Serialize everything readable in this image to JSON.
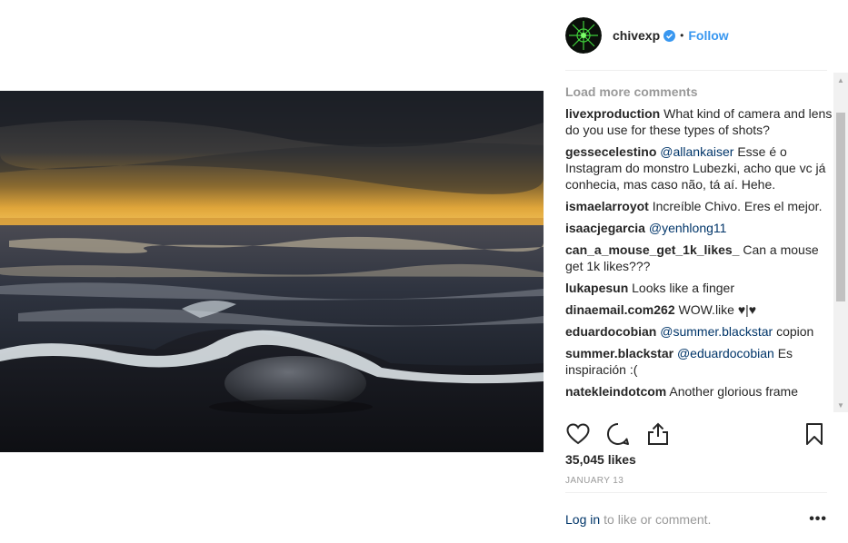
{
  "post": {
    "image_alt": "Waves washing over a rock on the shore at sunset"
  },
  "header": {
    "username": "chivexp",
    "separator": "•",
    "follow_label": "Follow"
  },
  "comments_section": {
    "load_more": "Load more comments",
    "items": [
      {
        "user": "livexproduction",
        "mention": "",
        "text": "What kind of camera and lens do you use for these types of shots?"
      },
      {
        "user": "gessecelestino",
        "mention": "@allankaiser",
        "text": "Esse é o Instagram do monstro Lubezki, acho que vc já conhecia, mas caso não, tá aí. Hehe."
      },
      {
        "user": "ismaelarroyot",
        "mention": "",
        "text": "Increíble Chivo. Eres el mejor."
      },
      {
        "user": "isaacjegarcia",
        "mention": "@yenhlong11",
        "text": ""
      },
      {
        "user": "can_a_mouse_get_1k_likes_",
        "mention": "",
        "text": "Can a mouse get 1k likes???"
      },
      {
        "user": "lukapesun",
        "mention": "",
        "text": "Looks like a finger"
      },
      {
        "user": "dinaemail.com262",
        "mention": "",
        "text": "WOW.like ♥|♥"
      },
      {
        "user": "eduardocobian",
        "mention": "@summer.blackstar",
        "text": "copion"
      },
      {
        "user": "summer.blackstar",
        "mention": "@eduardocobian",
        "text": "Es inspiración :("
      },
      {
        "user": "natekleindotcom",
        "mention": "",
        "text": "Another glorious frame"
      }
    ]
  },
  "stats": {
    "likes": "35,045 likes",
    "date": "JANUARY 13"
  },
  "footer": {
    "login_label": "Log in",
    "login_suffix": "to like or comment.",
    "more_label": "•••"
  },
  "icons": {
    "heart": "heart-icon",
    "comment": "comment-icon",
    "share": "share-icon",
    "bookmark": "bookmark-icon",
    "verified": "verified-badge-icon"
  },
  "colors": {
    "link_blue": "#3897f0",
    "username_link": "#003569",
    "muted": "#999999",
    "text": "#262626"
  }
}
